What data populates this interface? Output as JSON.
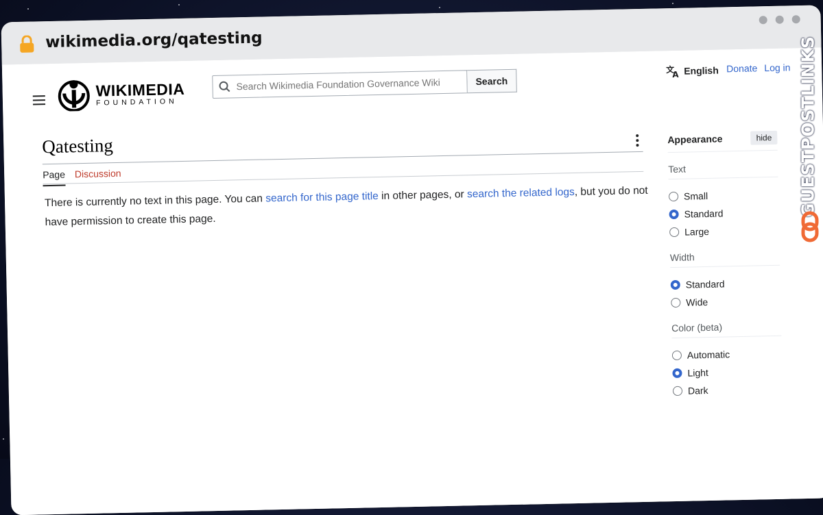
{
  "browser": {
    "url": "wikimedia.org/qatesting"
  },
  "header": {
    "logo_title": "WIKIMEDIA",
    "logo_subtitle": "FOUNDATION",
    "search_placeholder": "Search Wikimedia Foundation Governance Wiki",
    "search_button": "Search",
    "language": "English",
    "donate": "Donate",
    "login": "Log in"
  },
  "article": {
    "title": "Qatesting",
    "tabs": [
      "Page",
      "Discussion"
    ],
    "text_1": "There is currently no text in this page. You can ",
    "link_1": "search for this page title",
    "text_2": " in other pages, or ",
    "link_2": "search the related logs",
    "text_3": ", but you do not have permission to create this page."
  },
  "appearance": {
    "title": "Appearance",
    "hide": "hide",
    "text_label": "Text",
    "text_options": [
      "Small",
      "Standard",
      "Large"
    ],
    "width_label": "Width",
    "width_options": [
      "Standard",
      "Wide"
    ],
    "color_label": "Color (beta)",
    "color_options": [
      "Automatic",
      "Light",
      "Dark"
    ],
    "text_selected": "Standard",
    "width_selected": "Standard",
    "color_selected": "Light"
  },
  "watermark": {
    "text": "GUESTPOSTLINKS"
  },
  "colors": {
    "link": "#3366cc",
    "accent": "#f06a35"
  }
}
